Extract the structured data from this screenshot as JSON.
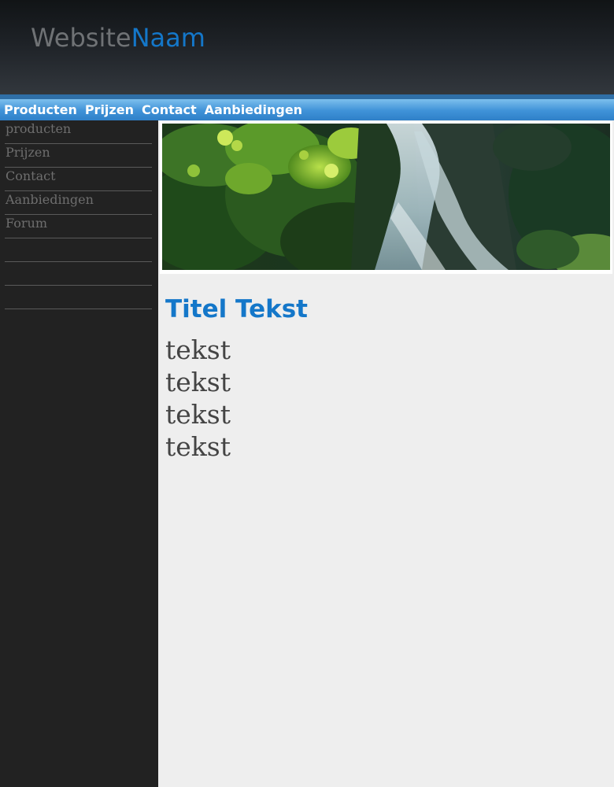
{
  "header": {
    "logo_part1": "Website",
    "logo_part2": "Naam"
  },
  "topnav": {
    "items": [
      {
        "label": "Producten"
      },
      {
        "label": "Prijzen"
      },
      {
        "label": "Contact"
      },
      {
        "label": "Aanbiedingen"
      }
    ]
  },
  "sidebar": {
    "items": [
      {
        "label": "producten"
      },
      {
        "label": "Prijzen"
      },
      {
        "label": "Contact"
      },
      {
        "label": "Aanbiedingen"
      },
      {
        "label": "Forum"
      },
      {
        "label": ""
      },
      {
        "label": ""
      },
      {
        "label": ""
      }
    ]
  },
  "main": {
    "title": "Titel Tekst",
    "lines": [
      "tekst",
      "tekst",
      "tekst",
      "tekst"
    ]
  },
  "colors": {
    "accent": "#1477c9",
    "header_bg": "#1e2227",
    "nav_bg": "#3f92d8",
    "sidebar_bg": "#222222",
    "content_bg": "#eeeeee"
  }
}
